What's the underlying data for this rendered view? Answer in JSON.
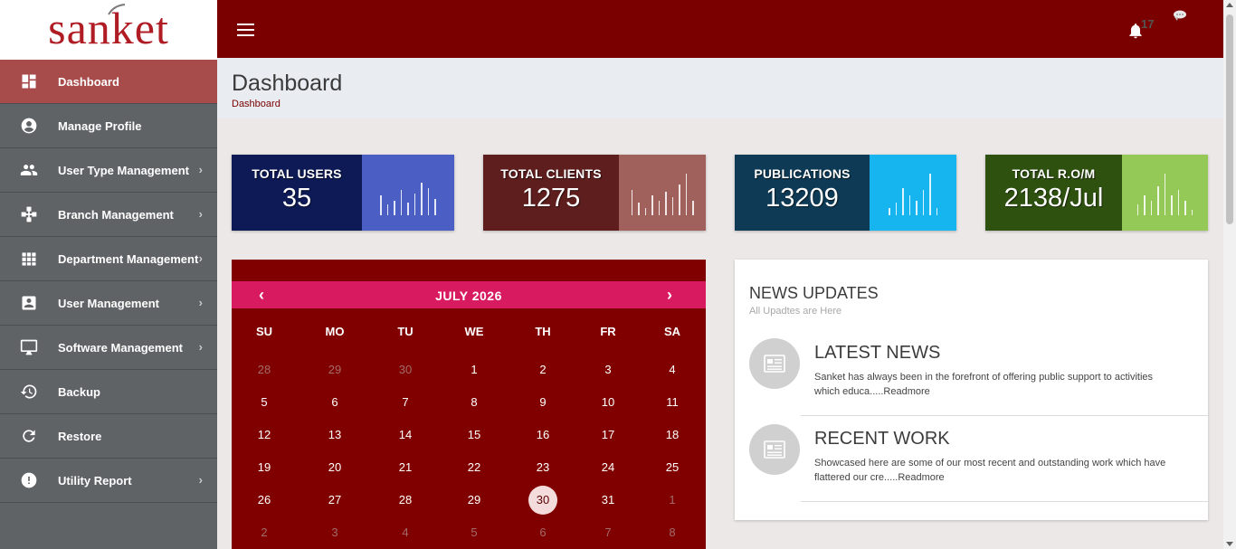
{
  "brand": {
    "logo_text": "sanket"
  },
  "sidebar": {
    "items": [
      {
        "label": "Dashboard",
        "icon": "dashboard-icon",
        "has_submenu": false,
        "active": true
      },
      {
        "label": "Manage Profile",
        "icon": "account-circle-icon",
        "has_submenu": false
      },
      {
        "label": "User Type Management",
        "icon": "people-icon",
        "has_submenu": true
      },
      {
        "label": "Branch Management",
        "icon": "branch-icon",
        "has_submenu": true
      },
      {
        "label": "Department Management",
        "icon": "grid-icon",
        "has_submenu": true
      },
      {
        "label": "User Management",
        "icon": "contact-card-icon",
        "has_submenu": true
      },
      {
        "label": "Software Management",
        "icon": "monitor-icon",
        "has_submenu": true
      },
      {
        "label": "Backup",
        "icon": "backup-restore-icon",
        "has_submenu": false
      },
      {
        "label": "Restore",
        "icon": "refresh-icon",
        "has_submenu": false
      },
      {
        "label": "Utility Report",
        "icon": "alert-circle-icon",
        "has_submenu": true
      }
    ],
    "chevron": "›"
  },
  "topbar": {
    "notification_count": "17",
    "menu_icon": "hamburger-icon",
    "bell_icon": "bell-icon",
    "avatar_icon": "avatar-icon"
  },
  "page": {
    "title": "Dashboard",
    "breadcrumb": "Dashboard"
  },
  "stats": [
    {
      "title": "TOTAL USERS",
      "value": "35",
      "color_dark": "#0d1a55",
      "color_light": "#4a5ec4"
    },
    {
      "title": "TOTAL CLIENTS",
      "value": "1275",
      "color_dark": "#5f1e1e",
      "color_light": "#a0605c"
    },
    {
      "title": "PUBLICATIONS",
      "value": "13209",
      "color_dark": "#0e3a55",
      "color_light": "#16b5f0"
    },
    {
      "title": "TOTAL R.O/M",
      "value": "2138/Jul",
      "color_dark": "#2f5110",
      "color_light": "#94c957"
    }
  ],
  "calendar": {
    "month_label": "JULY 2026",
    "prev": "‹",
    "next": "›",
    "weekdays": [
      "SU",
      "MO",
      "TU",
      "WE",
      "TH",
      "FR",
      "SA"
    ],
    "weeks": [
      [
        "28",
        "29",
        "30",
        "1",
        "2",
        "3",
        "4"
      ],
      [
        "5",
        "6",
        "7",
        "8",
        "9",
        "10",
        "11"
      ],
      [
        "12",
        "13",
        "14",
        "15",
        "16",
        "17",
        "18"
      ],
      [
        "19",
        "20",
        "21",
        "22",
        "23",
        "24",
        "25"
      ],
      [
        "26",
        "27",
        "28",
        "29",
        "30",
        "31",
        "1"
      ],
      [
        "2",
        "3",
        "4",
        "5",
        "6",
        "7",
        "8"
      ]
    ],
    "today": "30",
    "colors": {
      "body": "#800000",
      "header": "#d81b60"
    }
  },
  "news": {
    "title": "NEWS UPDATES",
    "subtitle": "All Upadtes are Here",
    "items": [
      {
        "heading": "LATEST NEWS",
        "text": "Sanket has always been in the forefront of offering public support to activities which educa.....Readmore",
        "icon": "newspaper-icon"
      },
      {
        "heading": "RECENT WORK",
        "text": "Showcased here are some of our most recent and outstanding work which have flattered our cre.....Readmore",
        "icon": "newspaper-icon"
      }
    ]
  },
  "colors": {
    "topbar": "#7a0000",
    "sidebar": "#5f6366",
    "sidebar_active": "#a84b4b"
  }
}
